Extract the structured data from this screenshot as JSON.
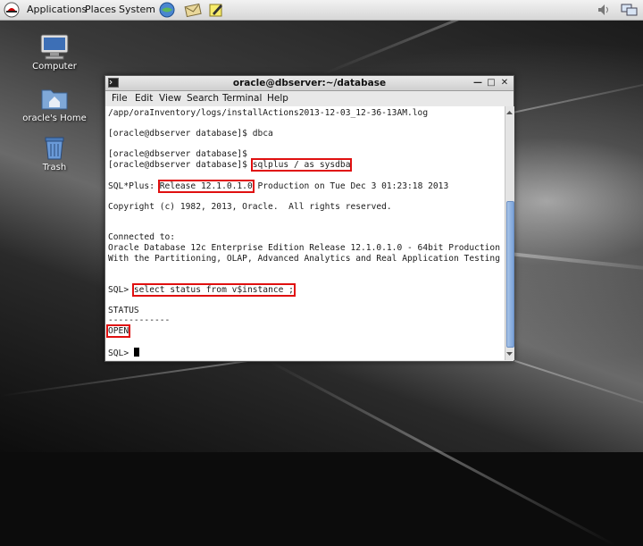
{
  "top_panel": {
    "menus": [
      "Applications",
      "Places",
      "System"
    ]
  },
  "desktop": {
    "icons": [
      "Computer",
      "oracle's Home",
      "Trash"
    ]
  },
  "terminal": {
    "title": "oracle@dbserver:~/database",
    "menus": [
      "File",
      "Edit",
      "View",
      "Search",
      "Terminal",
      "Help"
    ],
    "lines": [
      "/app/oraInventory/logs/installActions2013-12-03_12-36-13AM.log",
      "",
      "[oracle@dbserver database]$ dbca",
      "",
      "[oracle@dbserver database]$",
      "[oracle@dbserver database]$ ",
      "sqlplus / as sysdba",
      "SQL*Plus: ",
      "Release 12.1.0.1.0",
      " Production on Tue Dec 3 01:23:18 2013",
      "Copyright (c) 1982, 2013, Oracle.  All rights reserved.",
      "Connected to:",
      "Oracle Database 12c Enterprise Edition Release 12.1.0.1.0 - 64bit Production",
      "With the Partitioning, OLAP, Advanced Analytics and Real Application Testing options",
      "SQL> ",
      "select status from v$instance ;",
      "STATUS",
      "------------",
      "OPEN",
      "SQL> "
    ]
  },
  "colors": {
    "highlight": "#e01010",
    "scroll_thumb": "#7aa2d8"
  }
}
